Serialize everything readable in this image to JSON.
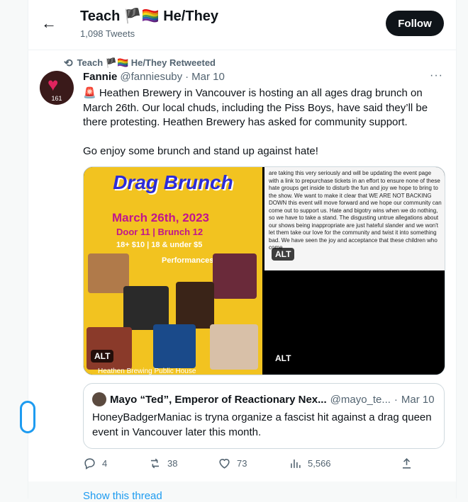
{
  "header": {
    "back_icon": "back-arrow-icon",
    "title": "Teach 🏴🏳️‍🌈 He/They",
    "tweet_count": "1,098 Tweets",
    "follow_label": "Follow"
  },
  "retweet": {
    "icon": "retweet-icon",
    "text": "Teach 🏴🏳️‍🌈 He/They Retweeted"
  },
  "tweet": {
    "avatar_badge": "161",
    "name": "Fannie",
    "handle": "@fanniesuby",
    "separator": "·",
    "time": "Mar 10",
    "more_label": "···",
    "text_1": "🚨 Heathen Brewery in Vancouver is hosting an all ages drag brunch on March 26th. Our local chuds, including the Piss Boys, have said they’ll be there protesting. Heathen Brewery has asked for community support.",
    "text_2": "Go enjoy some brunch and stand up against hate!",
    "media": {
      "flyer_title": "Drag Brunch",
      "flyer_date": "March 26th, 2023",
      "flyer_door": "Door 11 | Brunch 12",
      "flyer_price": "18+ $10 | 18 & under $5",
      "flyer_performers": "Performances by:",
      "flyer_footer": "Heathen Brewing Public House",
      "note_text": "are taking this very seriously and will be updating the event page with a link to prepurchase tickets in an effort to ensure none of these hate groups get inside to disturb the fun and joy we hope to bring to the show. We want to make it clear that WE ARE NOT BACKING DOWN this event will move forward and we hope our community can come out to support us. Hate and bigotry wins when we do nothing, so we have to take a stand. The disgusting untrue allegations about our shows being inappropriate are just hateful slander and we won't let them take our love for the community and twist it into something bad. We have seen the joy and acceptance that these children who come",
      "alt_label": "ALT"
    },
    "quote": {
      "name": "Mayo “Ted”, Emperor of Reactionary Nex...",
      "handle": "@mayo_te...",
      "separator": "·",
      "time": "Mar 10",
      "text": "HoneyBadgerManiac is tryna organize a fascist hit against a drag queen event in Vancouver later this month."
    },
    "actions": {
      "replies": "4",
      "retweets": "38",
      "likes": "73",
      "views": "5,566"
    }
  },
  "show_thread": "Show this thread",
  "colors": {
    "accent": "#1d9bf0",
    "text": "#0f1419",
    "muted": "#536471",
    "border": "#cfd9de"
  }
}
